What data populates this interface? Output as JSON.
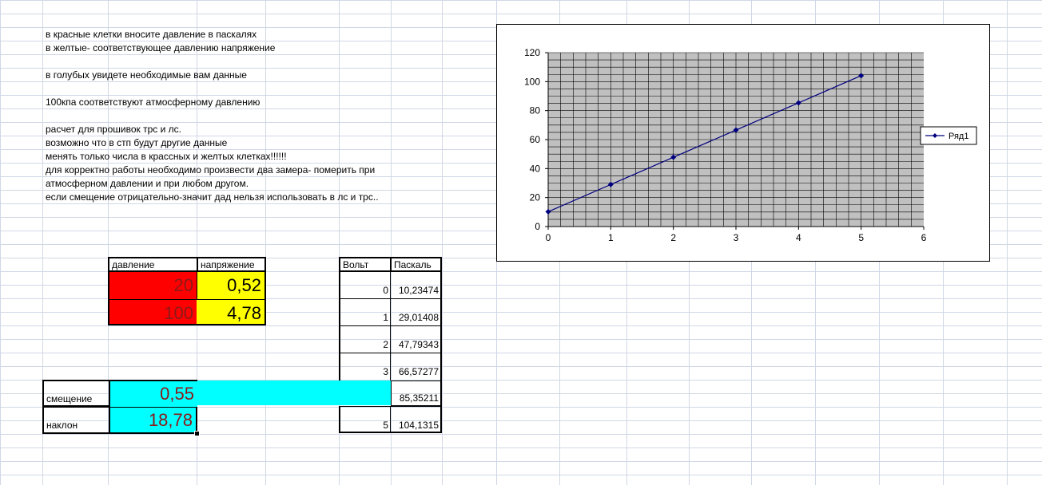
{
  "notes": [
    "в красные клетки вносите давление в паскалях",
    "в желтые- соответствующее давлению напряжение",
    "в голубых увидете необходимые вам данные",
    "100кпа соответствуют атмосферному давлению",
    "расчет для прошивок трс и лс.",
    "возможно  что в стп будут другие данные",
    "менять только числа в крассных и желтых клетках!!!!!!",
    "для корректно работы необходимо произвести два замера- померить при",
    "атмосферном давлении и при любом другом.",
    "если смещение отрицательно-значит дад нельзя использовать в лс и трс.."
  ],
  "input_table": {
    "header_pressure": "давление",
    "header_voltage": "напряжение",
    "rows": [
      {
        "pressure": "20",
        "voltage": "0,52"
      },
      {
        "pressure": "100",
        "voltage": "4,78"
      }
    ]
  },
  "results": {
    "offset_label": "смещение",
    "offset_value": "0,55",
    "slope_label": "наклон",
    "slope_value": "18,78"
  },
  "lookup_table": {
    "header_volt": "Вольт",
    "header_pascal": "Паскаль",
    "rows": [
      {
        "volt": "0",
        "pascal": "10,23474"
      },
      {
        "volt": "1",
        "pascal": "29,01408"
      },
      {
        "volt": "2",
        "pascal": "47,79343"
      },
      {
        "volt": "3",
        "pascal": "66,57277"
      },
      {
        "volt": "",
        "pascal": "85,35211"
      },
      {
        "volt": "5",
        "pascal": "104,1315"
      }
    ]
  },
  "colors": {
    "input_red": "#ff0000",
    "input_yellow": "#ffff00",
    "result_cyan": "#00ffff",
    "plot_bg": "#c0c0c0",
    "series": "#000080"
  },
  "chart_data": {
    "type": "line",
    "series": [
      {
        "name": "Ряд1",
        "x": [
          0,
          1,
          2,
          3,
          4,
          5
        ],
        "values": [
          10.23474,
          29.01408,
          47.79343,
          66.57277,
          85.35211,
          104.1315
        ]
      }
    ],
    "xlim": [
      0,
      6
    ],
    "ylim": [
      0,
      120
    ],
    "x_ticks": [
      "0",
      "1",
      "2",
      "3",
      "4",
      "5",
      "6"
    ],
    "y_ticks": [
      "0",
      "20",
      "40",
      "60",
      "80",
      "100",
      "120"
    ],
    "grid": true,
    "legend": "right",
    "title": "",
    "xlabel": "",
    "ylabel": ""
  }
}
